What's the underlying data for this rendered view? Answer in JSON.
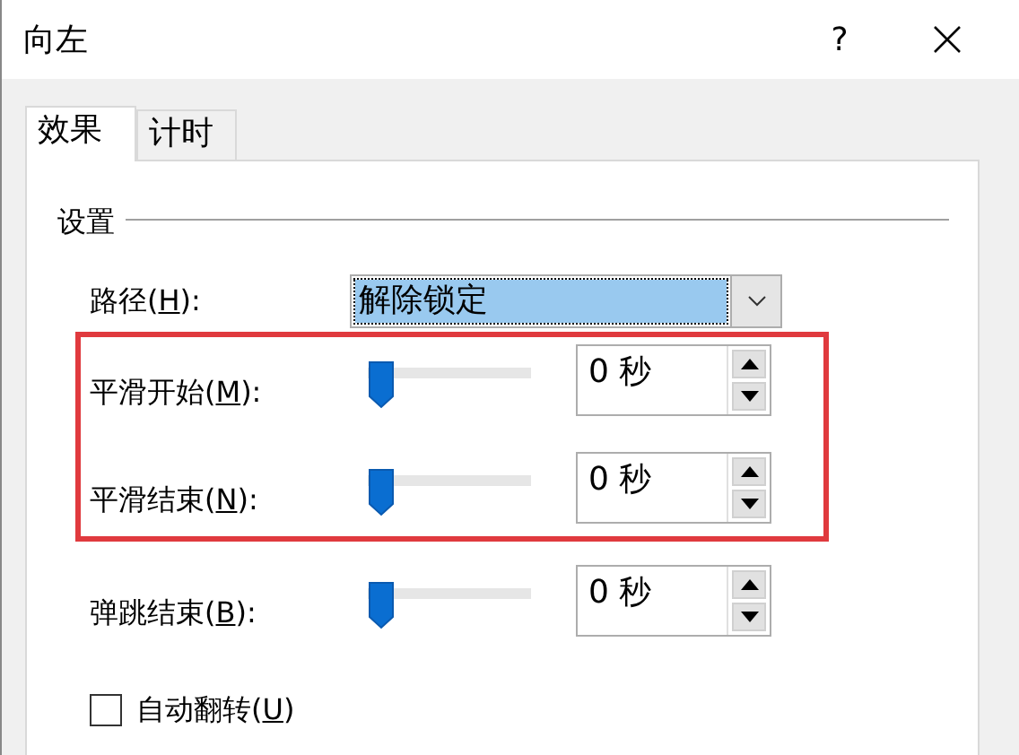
{
  "window": {
    "title": "向左",
    "help": "?"
  },
  "tabs": [
    {
      "label": "效果",
      "selected": true
    },
    {
      "label": "计时",
      "selected": false
    }
  ],
  "group": {
    "title": "设置"
  },
  "path": {
    "label_before": "路径(",
    "access_key": "H",
    "label_after": "):",
    "value": "解除锁定",
    "focused": true
  },
  "rows": [
    {
      "label_before": "平滑开始(",
      "access_key": "M",
      "label_after": "):",
      "level": 0,
      "value": "0 秒",
      "highlighted": true
    },
    {
      "label_before": "平滑结束(",
      "access_key": "N",
      "label_after": "):",
      "level": 0,
      "value": "0 秒",
      "highlighted": true
    },
    {
      "label_before": "弹跳结束(",
      "access_key": "B",
      "label_after": "):",
      "level": 0,
      "value": "0 秒",
      "highlighted": false
    }
  ],
  "checkbox": {
    "label_before": "自动翻转(",
    "access_key": "U",
    "label_after": ")",
    "checked": false
  }
}
